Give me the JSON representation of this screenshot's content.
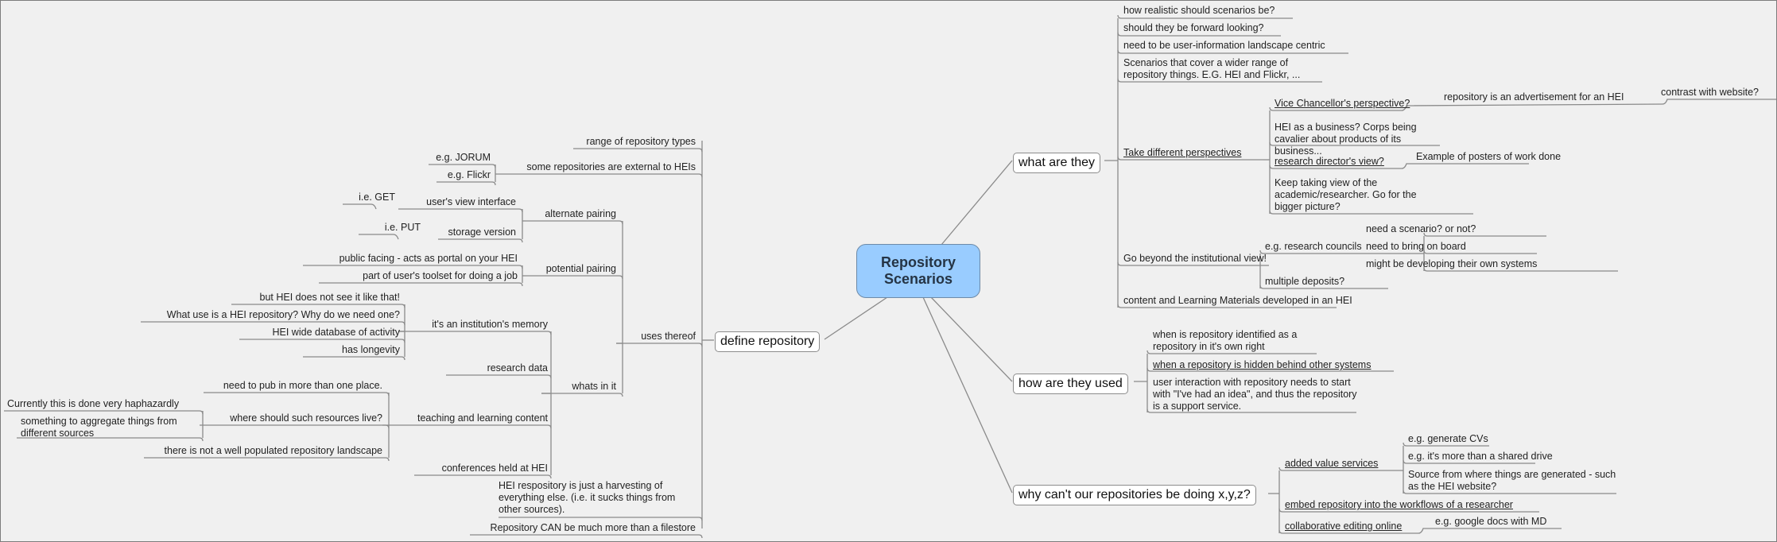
{
  "map_title": [
    "Repository",
    "Scenarios"
  ],
  "colors": {
    "root_fill": "#99ccff",
    "background": "#f0f0f0",
    "line": "#8a8a8a"
  },
  "define_repository": {
    "label": "define repository",
    "children": {
      "range": "range of repository types",
      "external": "some repositories are external to HEIs",
      "external_examples": [
        "e.g. JORUM",
        "e.g. Flickr"
      ],
      "uses": "uses thereof",
      "harvesting": "HEI respository is just a harvesting of everything else. (i.e. it sucks things from other sources).",
      "more_than_filestore": "Repository CAN be much more than a filestore"
    },
    "uses_thereof": {
      "alternate_pairing": "alternate pairing",
      "users_view": "user's view interface",
      "get": "i.e. GET",
      "storage_version": "storage version",
      "put": "i.e. PUT",
      "potential_pairing": "potential pairing",
      "public_facing": "public facing - acts as portal on your HEI",
      "toolset": "part of user's toolset for doing a job",
      "whats_in_it": "whats in it"
    },
    "whats_in_it": {
      "memory": "it's an institution's memory",
      "memory_children": [
        "but HEI does not see it like that!",
        "What use is a HEI repository? Why do we need one?",
        "HEI wide database of activity",
        "has longevity"
      ],
      "research_data": "research data",
      "teaching": "teaching and learning content",
      "teaching_children": {
        "pub": "need to pub in more than one place.",
        "where": "where should such resources live?",
        "haphazard": "Currently this is done very haphazardly",
        "aggregate": "something to aggregate things from different sources",
        "landscape": "there is not a well populated repository landscape"
      },
      "conferences": "conferences held at HEI"
    }
  },
  "what_are_they": {
    "label": "what are they",
    "items": [
      "how realistic should scenarios be?",
      "should they be forward looking?",
      "need to be user-information landscape centric",
      "Scenarios that cover a wider range of repository things. E.G. HEI and Flickr, ..."
    ],
    "perspectives": {
      "label": "Take different perspectives",
      "vc": "Vice Chancellor's perspective?",
      "vc_child": "repository is an advertisement for an HEI",
      "vc_grandchild": "contrast with website?",
      "business": "HEI as a business? Corps being cavalier about products of its business...",
      "research_director": "research director's view?",
      "rd_child": "Example of posters of work done",
      "academic": "Keep taking view of the academic/researcher. Go for the bigger picture?"
    },
    "beyond": {
      "label": "Go beyond the institutional view!",
      "councils": "e.g. research councils",
      "council_children": [
        "need a scenario? or not?",
        "need to bring on board",
        "might be developing their own systems"
      ],
      "multiple": "multiple deposits?"
    },
    "content": "content and Learning Materials developed in an HEI"
  },
  "how_used": {
    "label": "how are they used",
    "items": [
      "when is repository identified as a repository in it's own right",
      "when a repository is hidden behind other systems",
      "user interaction with repository needs to start with \"I've had an idea\", and thus the repository is a support service."
    ]
  },
  "why_cant": {
    "label": "why can't our repositories be doing x,y,z?",
    "added_value": "added value services",
    "added_value_children": [
      "e.g. generate CVs",
      "e.g. it's more than a shared drive",
      "Source from where things are generated - such as the HEI website?"
    ],
    "embed": "embed repository into the workflows of a researcher",
    "collab": "collaborative editing online",
    "collab_child": "e.g. google docs with MD"
  }
}
